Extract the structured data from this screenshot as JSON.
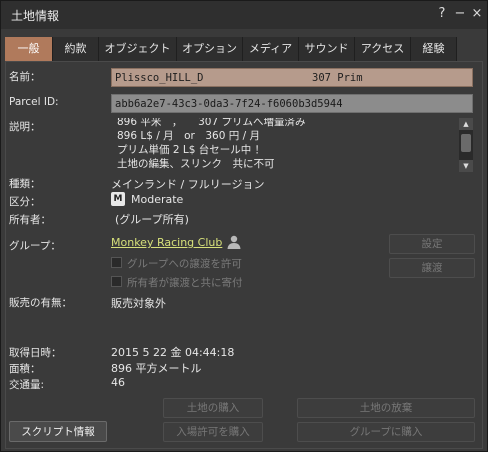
{
  "window": {
    "title": "土地情報",
    "help": "?",
    "minimize": "−",
    "close": "×"
  },
  "tabs": [
    "一般",
    "約款",
    "オブジェクト",
    "オプション",
    "メディア",
    "サウンド",
    "アクセス",
    "経験"
  ],
  "general": {
    "name_label": "名前：",
    "name_value": "Plissco_HILL_D",
    "prim_count": "307 Prim",
    "parcel_id_label": "Parcel ID:",
    "parcel_id_value": "abb6a2e7-43c3-0da3-7f24-f6060b3d5944",
    "desc_label": "説明：",
    "desc_lines": [
      "896 平米　，　　307 プリムへ増量済み",
      "896 L$ / 月　or　360 円 / 月",
      "プリム単価 2 L$ 台セール中 ！",
      "土地の編集、スリンク　共に不可"
    ],
    "type_label": "種類：",
    "type_value": "メインランド / フルリージョン",
    "rating_label": "区分：",
    "rating_badge": "M",
    "rating_value": "Moderate",
    "owner_label": "所有者：",
    "owner_value": "(グループ所有)",
    "group_label": "グループ：",
    "group_value": "Monkey Racing Club",
    "set_button": "設定",
    "deed_button": "譲渡",
    "allow_deed_label": "グループへの譲渡を許可",
    "owner_contrib_label": "所有者が譲渡と共に寄付",
    "for_sale_label": "販売の有無：",
    "for_sale_value": "販売対象外",
    "claimed_label": "取得日時：",
    "claimed_value": "2015 5 22 金 04:44:18",
    "area_label": "面積：",
    "area_value": "896 平方メートル",
    "traffic_label": "交通量:",
    "traffic_value": "46",
    "buy_land_button": "土地の購入",
    "abandon_button": "土地の放棄",
    "buy_pass_button": "入場許可を購入",
    "group_buy_button": "グループに購入",
    "script_info_button": "スクリプト情報"
  }
}
